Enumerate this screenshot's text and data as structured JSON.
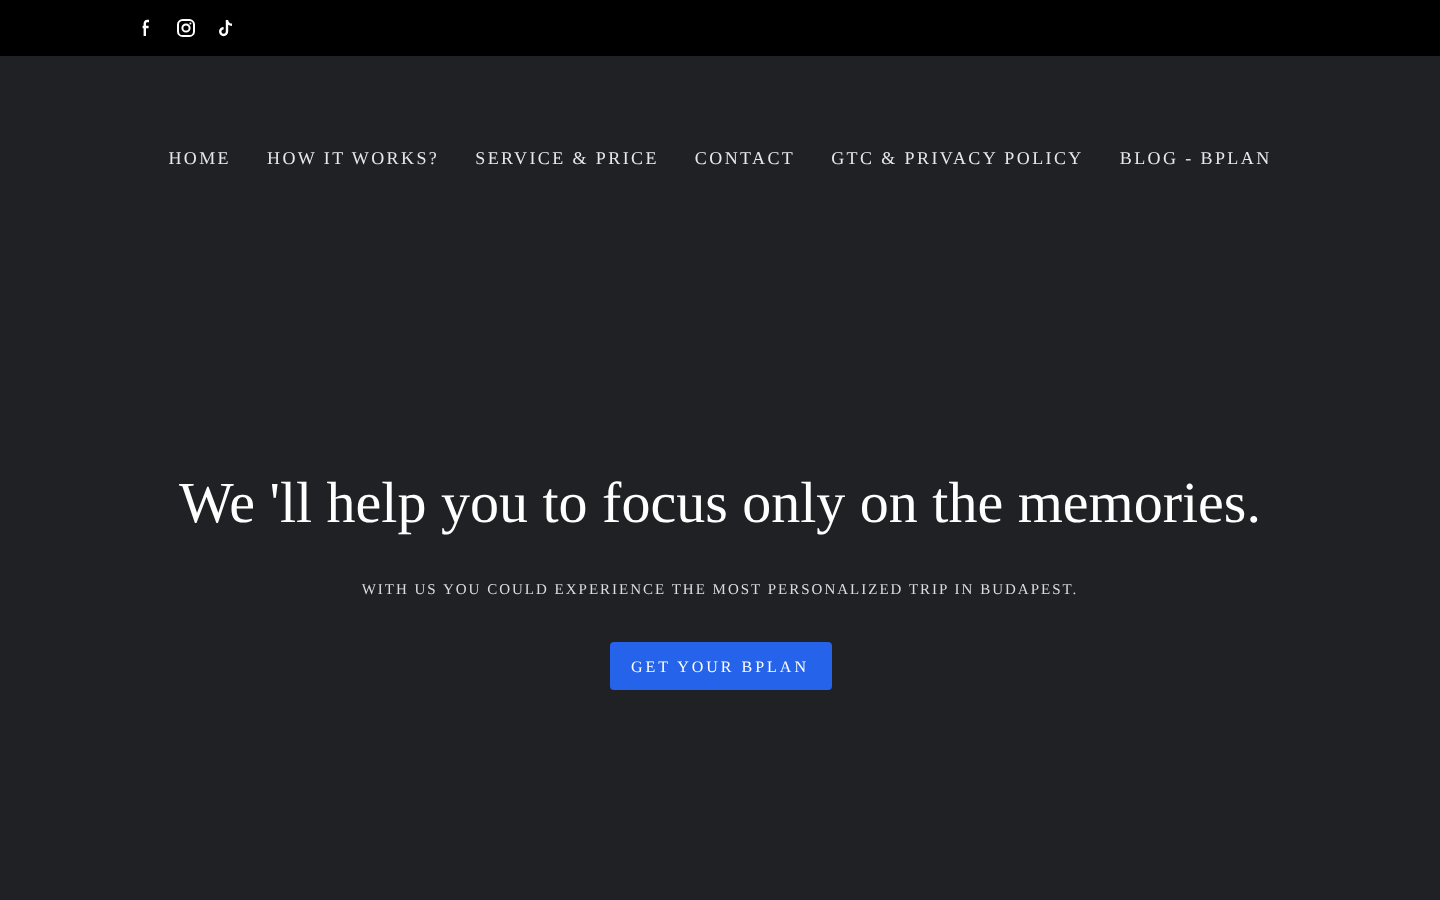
{
  "social_links": [
    {
      "kind": "facebook"
    },
    {
      "kind": "instagram"
    },
    {
      "kind": "tiktok"
    }
  ],
  "nav": {
    "items": [
      {
        "label": "HOME"
      },
      {
        "label": "HOW IT WORKS?"
      },
      {
        "label": "SERVICE & PRICE"
      },
      {
        "label": "CONTACT"
      },
      {
        "label": "GTC & PRIVACY POLICY"
      },
      {
        "label": "BLOG - BPLAN"
      }
    ]
  },
  "hero": {
    "heading": "We 'll help you to focus only on the memories.",
    "subtitle": "WITH US YOU COULD EXPERIENCE THE MOST PERSONALIZED TRIP IN BUDAPEST.",
    "button": "GET YOUR BPLAN"
  }
}
